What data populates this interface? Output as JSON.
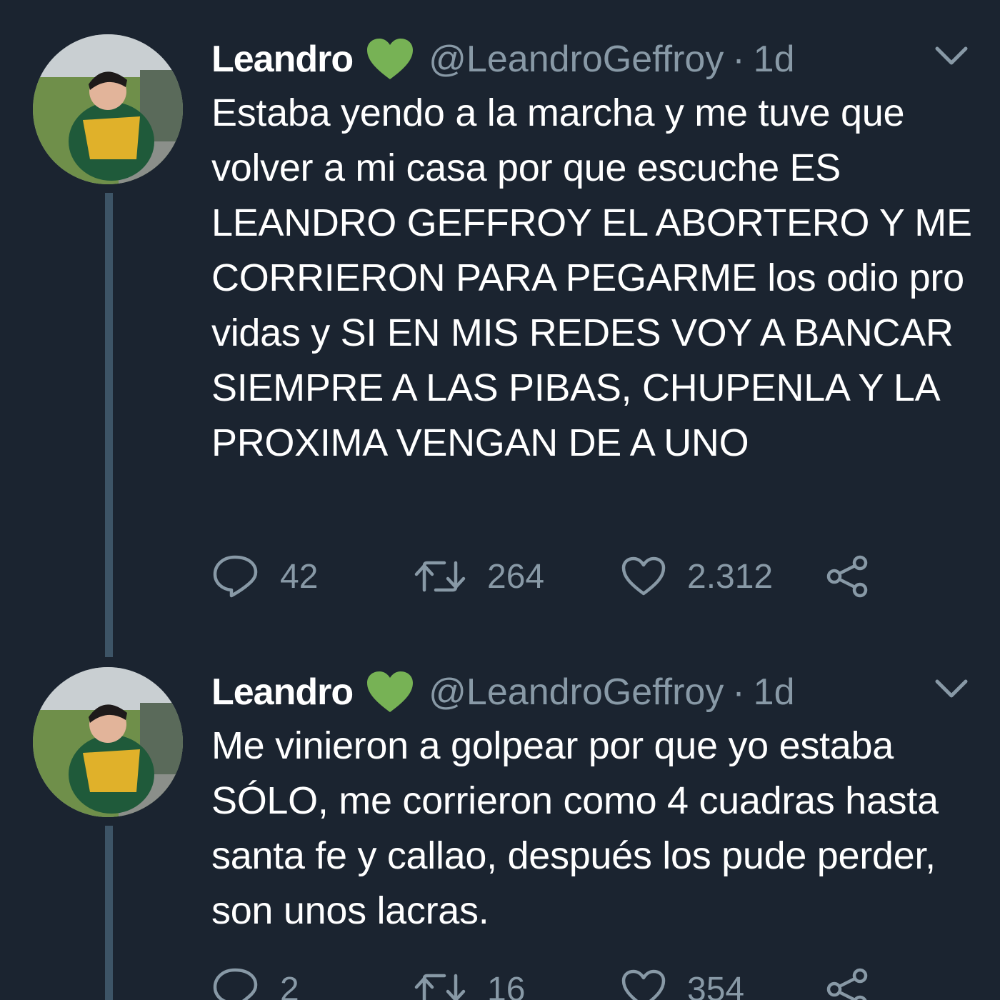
{
  "tweets": [
    {
      "name": "Leandro",
      "handle": "@LeandroGeffroy",
      "separator": "·",
      "age": "1d",
      "text": "Estaba yendo a la marcha y me tuve que volver a mi casa por que escuche ES LEANDRO GEFFROY EL ABORTERO Y ME CORRIERON PARA PEGARME los odio pro vidas y SI EN MIS REDES VOY A BANCAR SIEMPRE A LAS PIBAS, CHUPENLA Y LA PROXIMA VENGAN DE A UNO",
      "replies": "42",
      "retweets": "264",
      "likes": "2.312"
    },
    {
      "name": "Leandro",
      "handle": "@LeandroGeffroy",
      "separator": "·",
      "age": "1d",
      "text": "Me vinieron a golpear por que yo estaba SÓLO, me corrieron como 4 cuadras hasta santa fe y callao, después los pude perder, son unos lacras.",
      "replies": "2",
      "retweets": "16",
      "likes": "354"
    }
  ],
  "icons": {
    "badge": "green-heart-icon",
    "menu": "chevron-down-icon",
    "reply": "reply-icon",
    "retweet": "retweet-icon",
    "like": "heart-outline-icon",
    "share": "share-icon"
  },
  "colors": {
    "background": "#1b2430",
    "text": "#ffffff",
    "muted": "#8899a6",
    "thread_line": "#3d5466",
    "badge_green": "#77b255"
  }
}
